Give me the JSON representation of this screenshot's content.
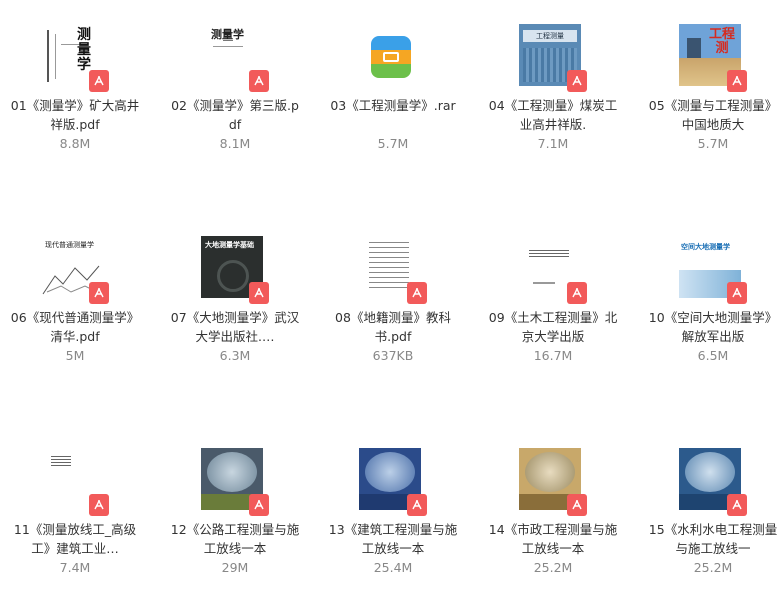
{
  "files": [
    {
      "name": "01《测量学》矿大高井祥版.pdf",
      "size": "8.8M",
      "icon": "pdf-icon"
    },
    {
      "name": "02《测量学》第三版.pdf",
      "size": "8.1M",
      "icon": "pdf-icon"
    },
    {
      "name": "03《工程测量学》.rar",
      "size": "5.7M",
      "icon": "rar-icon"
    },
    {
      "name": "04《工程测量》煤炭工业高井祥版.",
      "size": "7.1M",
      "icon": "pdf-icon"
    },
    {
      "name": "05《测量与工程测量》中国地质大",
      "size": "5.7M",
      "icon": "pdf-icon"
    },
    {
      "name": "06《现代普通测量学》清华.pdf",
      "size": "5M",
      "icon": "pdf-icon"
    },
    {
      "name": "07《大地测量学》武汉大学出版社.…",
      "size": "6.3M",
      "icon": "pdf-icon"
    },
    {
      "name": "08《地籍测量》教科书.pdf",
      "size": "637KB",
      "icon": "pdf-icon"
    },
    {
      "name": "09《土木工程测量》北京大学出版",
      "size": "16.7M",
      "icon": "pdf-icon"
    },
    {
      "name": "10《空间大地测量学》解放军出版",
      "size": "6.5M",
      "icon": "pdf-icon"
    },
    {
      "name": "11《测量放线工_高级工》建筑工业…",
      "size": "7.4M",
      "icon": "pdf-icon"
    },
    {
      "name": "12《公路工程测量与施工放线一本",
      "size": "29M",
      "icon": "pdf-icon"
    },
    {
      "name": "13《建筑工程测量与施工放线一本",
      "size": "25.4M",
      "icon": "pdf-icon"
    },
    {
      "name": "14《市政工程测量与施工放线一本",
      "size": "25.2M",
      "icon": "pdf-icon"
    },
    {
      "name": "15《水利水电工程测量与施工放线一",
      "size": "25.2M",
      "icon": "pdf-icon"
    }
  ],
  "covers": {
    "c1_title": "测量学",
    "c2_title": "测量学",
    "c4_title": "工程测量",
    "c5_title": "工程测",
    "c6_title": "现代普通测量学",
    "c7_title": "大地测量学基础",
    "c10_title": "空间大地测量学"
  },
  "colors": {
    "pdf_badge": "#f25a5a",
    "text": "#333333",
    "size_text": "#888888"
  }
}
